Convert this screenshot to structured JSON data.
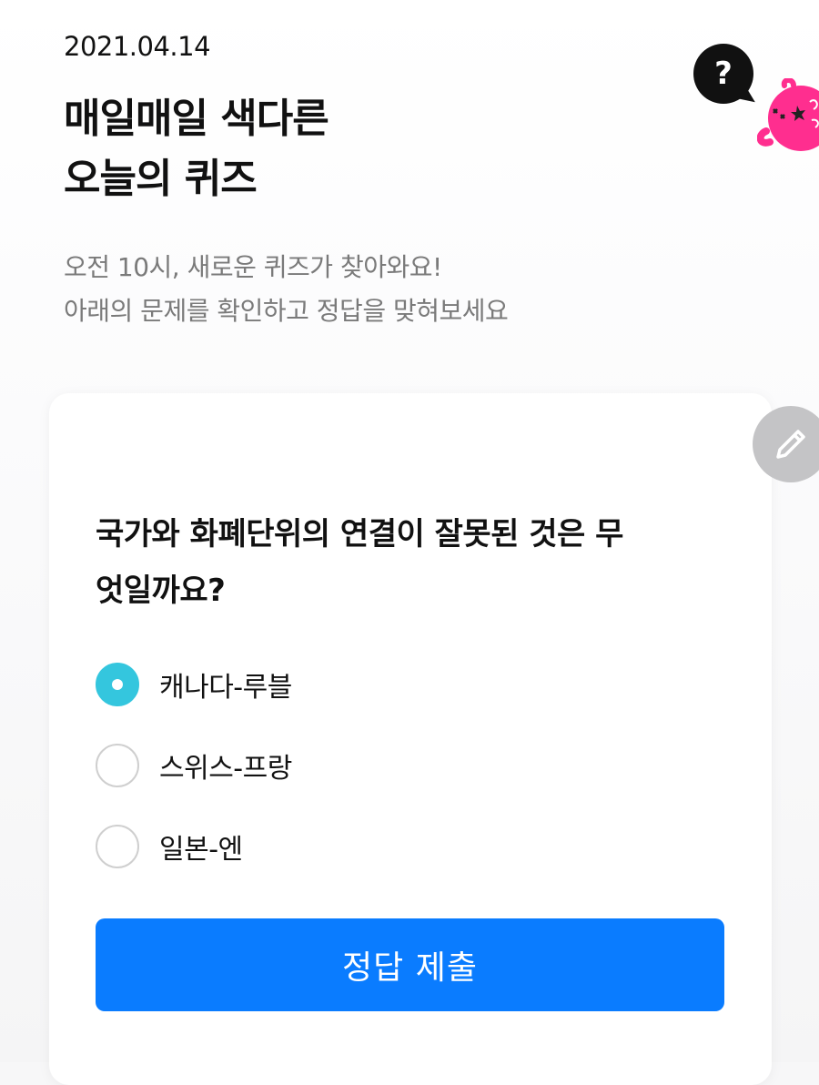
{
  "header": {
    "date": "2021.04.14",
    "title_lines": [
      "매일매일 색다른",
      "오늘의 퀴즈"
    ],
    "subtitle_lines": [
      "오전 10시, 새로운 퀴즈가 찾아와요!",
      "아래의 문제를 확인하고 정답을 맞혀보세요"
    ]
  },
  "help": {
    "icon": "question-mark-icon",
    "label": "?"
  },
  "mascot": {
    "icon": "pink-mascot-icon",
    "color": "#ff2e8f"
  },
  "quiz": {
    "question_lines": [
      "국가와 화폐단위의 연결이 잘못된 것은 무",
      "엇일까요?"
    ],
    "options": [
      {
        "label": "캐나다-루블",
        "selected": true
      },
      {
        "label": "스위스-프랑",
        "selected": false
      },
      {
        "label": "일본-엔",
        "selected": false
      }
    ],
    "submit_label": "정답 제출"
  },
  "edit_button": {
    "icon": "pencil-icon"
  },
  "colors": {
    "accent_blue": "#0a7cff",
    "radio_selected": "#34c6de",
    "subtext_gray": "#7a7a7a",
    "fab_gray": "#c4c4c6"
  }
}
